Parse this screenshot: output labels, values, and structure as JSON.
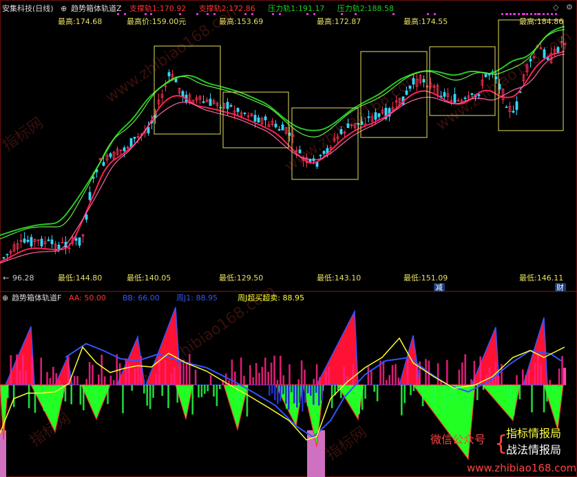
{
  "header": {
    "title": "安集科技(日线)",
    "indicator_name": "趋势箱体轨道Z",
    "legend": [
      {
        "label": "支撑轨1:",
        "value": "170.92",
        "color": "#ff3333"
      },
      {
        "label": "支撑轨2:",
        "value": "172.86",
        "color": "#ff3333"
      },
      {
        "label": "压力轨1:",
        "value": "191.17",
        "color": "#22cc22"
      },
      {
        "label": "压力轨2:",
        "value": "188.58",
        "color": "#22cc22"
      }
    ]
  },
  "boxes": [
    {
      "high_label": "最高:174.68",
      "low_label": "最低:144.80"
    },
    {
      "high_label": "最高价:159.00元",
      "low_label": "最低:140.05"
    },
    {
      "high_label": "最高:153.69",
      "low_label": "最低:129.50"
    },
    {
      "high_label": "最高:172.87",
      "low_label": "最低:143.10"
    },
    {
      "high_label": "最高:174.55",
      "low_label": "最低:151.09"
    },
    {
      "high_label": "最高:184.86",
      "low_label": "最低:146.11"
    }
  ],
  "price_axis": {
    "min_label": "96.28"
  },
  "badges": {
    "jian": "减",
    "cai": "财"
  },
  "sub_header": {
    "indicator_name": "趋势箱体轨道F",
    "legend": [
      {
        "label": "AA:",
        "value": "50.00",
        "color": "#ff3333"
      },
      {
        "label": "BB:",
        "value": "66.00",
        "color": "#3355ff"
      },
      {
        "label": "周J1:",
        "value": "88.95",
        "color": "#3355ff"
      },
      {
        "label": "周J超买超卖:",
        "value": "88.95",
        "color": "#ffff33"
      }
    ]
  },
  "watermarks": {
    "site": "www.zhibiao168.com",
    "cn": "指标网",
    "wechat": "微信公众号",
    "brand1": "指标情报局",
    "brand2": "战法情报局",
    "footer": "www.zhibiao168.com"
  },
  "chart_data": [
    {
      "type": "line",
      "title": "趋势箱体轨道Z",
      "note": "candlestick price with support/pressure rails",
      "series": [
        {
          "name": "支撑轨1",
          "last": 170.92
        },
        {
          "name": "支撑轨2",
          "last": 172.86
        },
        {
          "name": "压力轨1",
          "last": 191.17
        },
        {
          "name": "压力轨2",
          "last": 188.58
        }
      ],
      "box_highs": [
        174.68,
        159.0,
        153.69,
        172.87,
        174.55,
        184.86
      ],
      "box_lows": [
        144.8,
        140.05,
        129.5,
        143.1,
        151.09,
        146.11
      ],
      "price_min": 96.28
    },
    {
      "type": "bar",
      "title": "趋势箱体轨道F",
      "series": [
        {
          "name": "AA",
          "last": 50.0
        },
        {
          "name": "BB",
          "last": 66.0
        },
        {
          "name": "周J1",
          "last": 88.95
        },
        {
          "name": "周J超买超卖",
          "last": 88.95
        }
      ]
    }
  ]
}
